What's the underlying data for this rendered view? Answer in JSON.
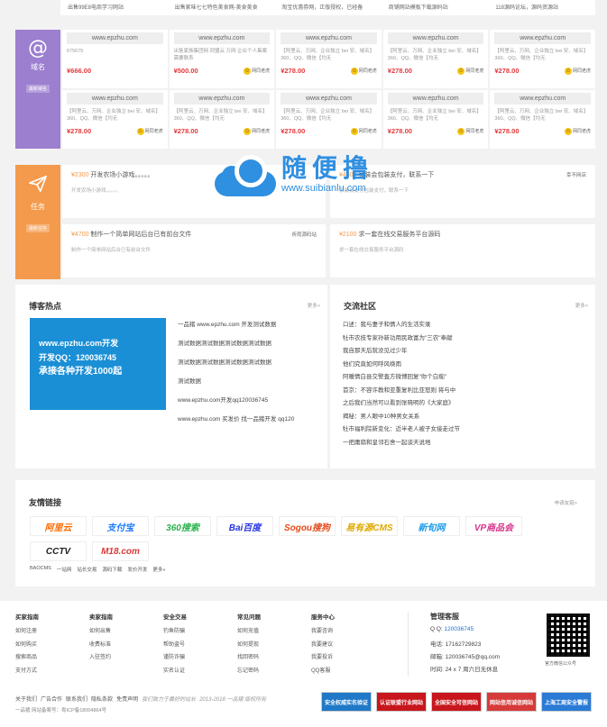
{
  "top_strip": [
    "出售99E8电商学习网站",
    "出售家味七七特色美食网-美食美食",
    "淘宝优惠券网，正版授权，已经备",
    "商铺网站模板下载源码站",
    "118源码论坛，源码资源站"
  ],
  "domain_section": {
    "name": "域名",
    "icon": "@",
    "badge": "最新域名",
    "cards": [
      {
        "domain": "www.epzhu.com",
        "desc": "675675",
        "price": "¥666.00",
        "seller": "",
        "face": false
      },
      {
        "domain": "www.epzhu.com",
        "desc": "出售家族集团网 同盟云 万网 企业个人集案 需要联系",
        "price": "¥500.00",
        "seller": "网同老虎",
        "face": true
      },
      {
        "domain": "www.epzhu.com",
        "desc": "【阿里云、万网、企业独立 bei 安、域名】360、QQ、微信【均无",
        "price": "¥278.00",
        "seller": "网同老虎",
        "face": true
      },
      {
        "domain": "www.epzhu.com",
        "desc": "【阿里云、万网、企业独立 bei 安、域名】360、QQ、微信【均无",
        "price": "¥278.00",
        "seller": "网同老虎",
        "face": true
      },
      {
        "domain": "www.epzhu.com",
        "desc": "【阿里云、万网、企业独立 bei 安、域名】360、QQ、微信【均无",
        "price": "¥278.00",
        "seller": "网同老虎",
        "face": true
      },
      {
        "domain": "www.epzhu.com",
        "desc": "【阿里云、万网、企业独立 bei 安、域名】360、QQ、微信【均无",
        "price": "¥278.00",
        "seller": "网同老虎",
        "face": true
      },
      {
        "domain": "www.epzhu.com",
        "desc": "【阿里云、万网、企业独立 bei 安、域名】360、QQ、微信【均无",
        "price": "¥278.00",
        "seller": "网同老虎",
        "face": true
      },
      {
        "domain": "www.epzhu.com",
        "desc": "【阿里云、万网、企业独立 bei 安、域名】360、QQ、微信【均无",
        "price": "¥278.00",
        "seller": "网同老虎",
        "face": true
      },
      {
        "domain": "www.epzhu.com",
        "desc": "【阿里云、万网、企业独立 bei 安、域名】360、QQ、微信【均无",
        "price": "¥278.00",
        "seller": "网同老虎",
        "face": true
      },
      {
        "domain": "www.epzhu.com",
        "desc": "【阿里云、万网、企业独立 bei 安、域名】360、QQ、微信【均无",
        "price": "¥278.00",
        "seller": "网同老虎",
        "face": true
      }
    ]
  },
  "task_section": {
    "name": "任务",
    "badge": "最新任务",
    "tasks": [
      {
        "price": "¥2300",
        "title": "开发农场小游戏。。。。。",
        "desc": "开发农场小游戏。。。。。",
        "user": ""
      },
      {
        "price": "¥4500",
        "title": "家装会包装支付，联系一下",
        "desc": "家装会支付包装支付，联系一下",
        "user": "幸不网店"
      },
      {
        "price": "¥4700",
        "title": "制作一个简单网站后台已有前台文件",
        "desc": "制作一个简单网站后台已有前台文件",
        "user": "祈雨源码站"
      },
      {
        "price": "¥2100",
        "title": "求一套在线交易服务平台源码",
        "desc": "求一套在线交易服务平台源码",
        "user": ""
      }
    ]
  },
  "watermark": {
    "cn": "随便撸",
    "url": "www.suibianlu.com"
  },
  "blog": {
    "title": "博客热点",
    "more": "更多>",
    "banner": [
      "www.epzhu.com开发",
      "开发QQ：120036745",
      "承接各种开发1000起"
    ],
    "items": [
      "一品猪 www.epzhu.com 开发测试数据",
      "测试数据测试数据测试数据测试数据",
      "测试数据测试数据测试数据测试数据",
      "测试数据",
      "www.epzhu.com开发qq120036745",
      "www.epzhu.com 买发价 找一品猪开发 qq120"
    ]
  },
  "community": {
    "title": "交流社区",
    "more": "更多>",
    "items": [
      "口述：我与妻子和情人的生活实录",
      "牡市农技专家孙新功用民政富为\"三农\"奉献",
      "我自那天后就没见过少年",
      "他们究竟如何呼风唤雨",
      "阿暖情白县交警査方微博回复\"你个白痴\"",
      "首京：不容许教和亚重复利比亚怒则 将与中",
      "之后我们当然可以看到张晓明的《大家庭》",
      "揭秘：男人眼中10种男女关系",
      "牡市福利院新变化：近半老人被子女接走过节",
      "一把庸扇和皇邻石舍一起谈天说地"
    ]
  },
  "friends": {
    "title": "友情链接",
    "apply": "申请友链>",
    "logos": [
      {
        "name": "阿里云",
        "color": "#ff6a00"
      },
      {
        "name": "支付宝",
        "color": "#1677ff"
      },
      {
        "name": "360搜索",
        "color": "#2bb24c"
      },
      {
        "name": "Bai百度",
        "color": "#2932e1"
      },
      {
        "name": "Sogou搜狗",
        "color": "#e64a19"
      },
      {
        "name": "易有源CMS",
        "color": "#e0a800"
      },
      {
        "name": "新旬网",
        "color": "#1e9be8"
      },
      {
        "name": "VP商品会",
        "color": "#d6338a"
      },
      {
        "name": "CCTV",
        "color": "#222222"
      },
      {
        "name": "M18.com",
        "color": "#d83a3a"
      }
    ],
    "text_links": [
      "BAOCMS",
      "一站网",
      "站长交易",
      "源码下载",
      "发价开发",
      "更多»"
    ]
  },
  "footer": {
    "columns": [
      {
        "title": "买家指南",
        "items": [
          "如何注册",
          "如何购买",
          "搜索商品",
          "支付方式"
        ]
      },
      {
        "title": "卖家指南",
        "items": [
          "如何出售",
          "收费标准",
          "入驻签约"
        ]
      },
      {
        "title": "安全交易",
        "items": [
          "钓鱼防骗",
          "帮助盗号",
          "谨防诈骗",
          "实名认证"
        ]
      },
      {
        "title": "常见问题",
        "items": [
          "如何充值",
          "如何提现",
          "找回密码",
          "忘记密码"
        ]
      },
      {
        "title": "服务中心",
        "items": [
          "我要咨询",
          "我要建议",
          "我要投诉",
          "QQ客服"
        ]
      }
    ],
    "service": {
      "title": "管理客服",
      "qq_label": "Q Q:",
      "qq": "120036745",
      "phone_label": "电话:",
      "phone": "17162729823",
      "email_label": "邮箱:",
      "email": "120036745@qq.com",
      "time_label": "时间:",
      "time": "24 x 7 周六日无休息"
    },
    "qr_caption": "官方微信公众号",
    "bottom_links": [
      "关于我们",
      "广告合作",
      "联系我们",
      "隐私条款",
      "免责声明"
    ],
    "tagline": "我们致力于最好的站长",
    "copyright": "2013-2018 一品猪 版权所有",
    "icp": "一品猪 网站备案号：粤ICP备18004864号",
    "badges": [
      {
        "label": "安全权威实名验证",
        "color": "#1f78c8"
      },
      {
        "label": "认证联盟行业网站",
        "color": "#c8161d"
      },
      {
        "label": "全国安全可信网站",
        "color": "#c8161d"
      },
      {
        "label": "网站信用诚信网站",
        "color": "#d63a3a"
      },
      {
        "label": "上海工商安全警报",
        "color": "#2a7ad6"
      }
    ]
  }
}
